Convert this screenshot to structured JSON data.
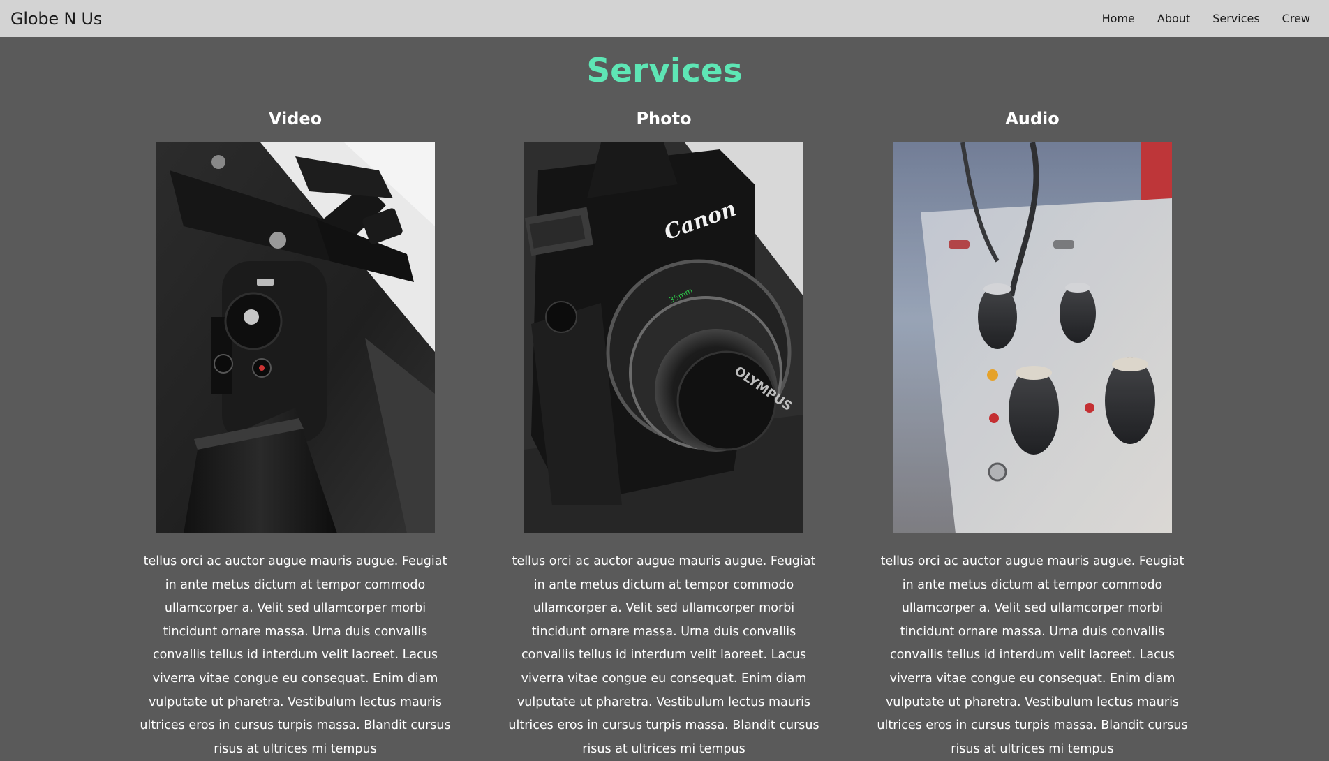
{
  "nav": {
    "brand": "Globe N Us",
    "links": [
      "Home",
      "About",
      "Services",
      "Crew"
    ]
  },
  "page": {
    "title": "Services"
  },
  "services": [
    {
      "title": "Video",
      "image_icon": "gimbal-stabilizer-photo",
      "text": "tellus orci ac auctor augue mauris augue. Feugiat in ante metus dictum at tempor commodo ullamcorper a. Velit sed ullamcorper morbi tincidunt ornare massa. Urna duis convallis convallis tellus id interdum velit laoreet. Lacus viverra vitae congue eu consequat. Enim diam vulputate ut pharetra. Vestibulum lectus mauris ultrices eros in cursus turpis massa. Blandit cursus risus at ultrices mi tempus"
    },
    {
      "title": "Photo",
      "image_icon": "camera-photo",
      "image_text": [
        "Canon",
        "OLYMPUS",
        "35mm"
      ],
      "text": "tellus orci ac auctor augue mauris augue. Feugiat in ante metus dictum at tempor commodo ullamcorper a. Velit sed ullamcorper morbi tincidunt ornare massa. Urna duis convallis convallis tellus id interdum velit laoreet. Lacus viverra vitae congue eu consequat. Enim diam vulputate ut pharetra. Vestibulum lectus mauris ultrices eros in cursus turpis massa. Blandit cursus risus at ultrices mi tempus"
    },
    {
      "title": "Audio",
      "image_icon": "mixing-console-photo",
      "text": "tellus orci ac auctor augue mauris augue. Feugiat in ante metus dictum at tempor commodo ullamcorper a. Velit sed ullamcorper morbi tincidunt ornare massa. Urna duis convallis convallis tellus id interdum velit laoreet. Lacus viverra vitae congue eu consequat. Enim diam vulputate ut pharetra. Vestibulum lectus mauris ultrices eros in cursus turpis massa. Blandit cursus risus at ultrices mi tempus"
    }
  ],
  "colors": {
    "navbar_bg": "#d3d3d3",
    "page_bg": "#5a5a5a",
    "title_accent": "#5ee6b5",
    "text": "#ffffff"
  }
}
